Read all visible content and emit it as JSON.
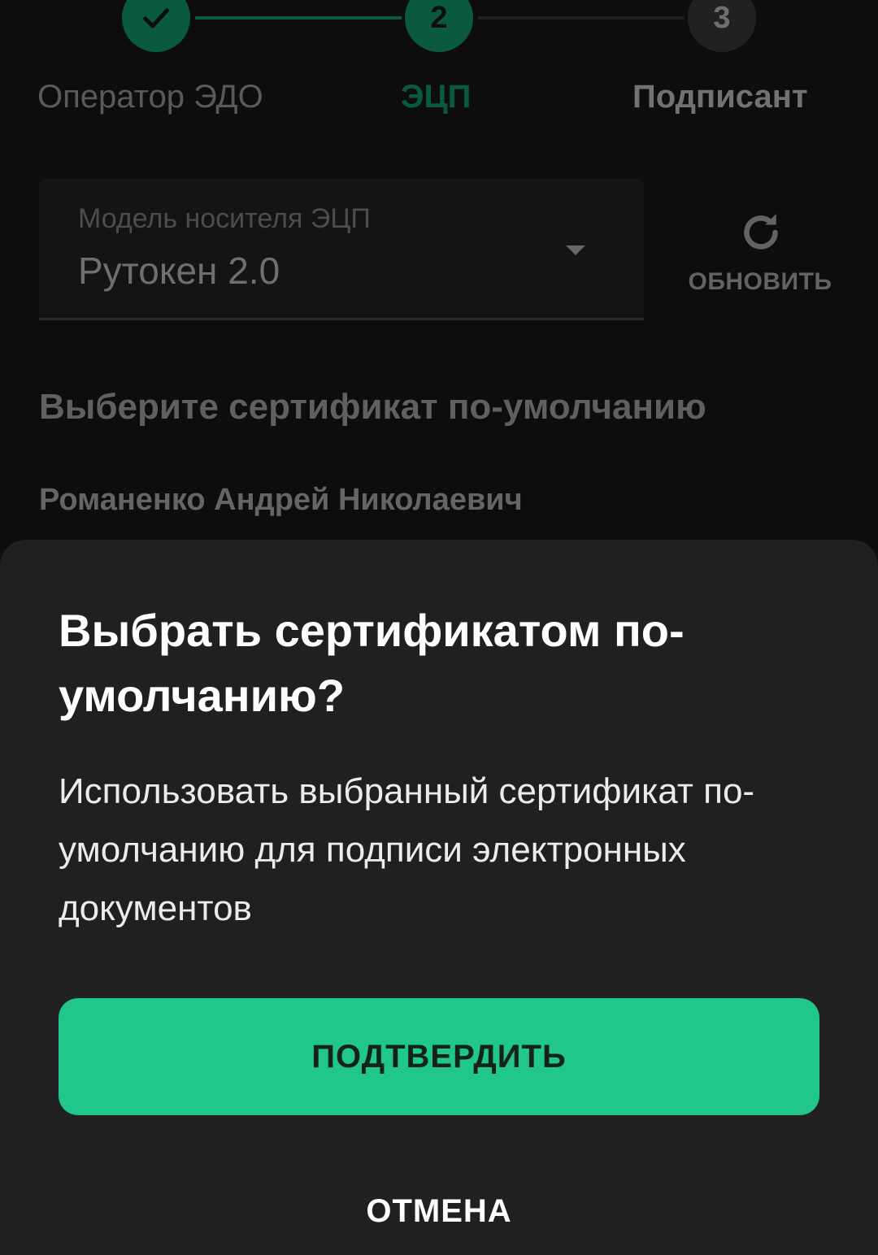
{
  "stepper": {
    "steps": [
      {
        "number": "",
        "label": "Оператор ЭДО",
        "state": "done"
      },
      {
        "number": "2",
        "label": "ЭЦП",
        "state": "active"
      },
      {
        "number": "3",
        "label": "Подписант",
        "state": "upcoming"
      }
    ]
  },
  "media_select": {
    "label": "Модель носителя ЭЦП",
    "value": "Рутокен 2.0"
  },
  "refresh": {
    "label": "ОБНОВИТЬ"
  },
  "certificates": {
    "title": "Выберите сертификат по-умолчанию",
    "items": [
      "Романенко Андрей Николаевич"
    ]
  },
  "dialog": {
    "title": "Выбрать сертификатом по-умолчанию?",
    "text": "Использовать выбранный сертификат по-умолчанию для подписи электронных документов",
    "confirm_label": "ПОДТВЕРДИТЬ",
    "cancel_label": "ОТМЕНА"
  },
  "colors": {
    "accent": "#20c68a",
    "accent_dark": "#0f7d58",
    "sheet_bg": "#201f21",
    "background": "#121212"
  }
}
